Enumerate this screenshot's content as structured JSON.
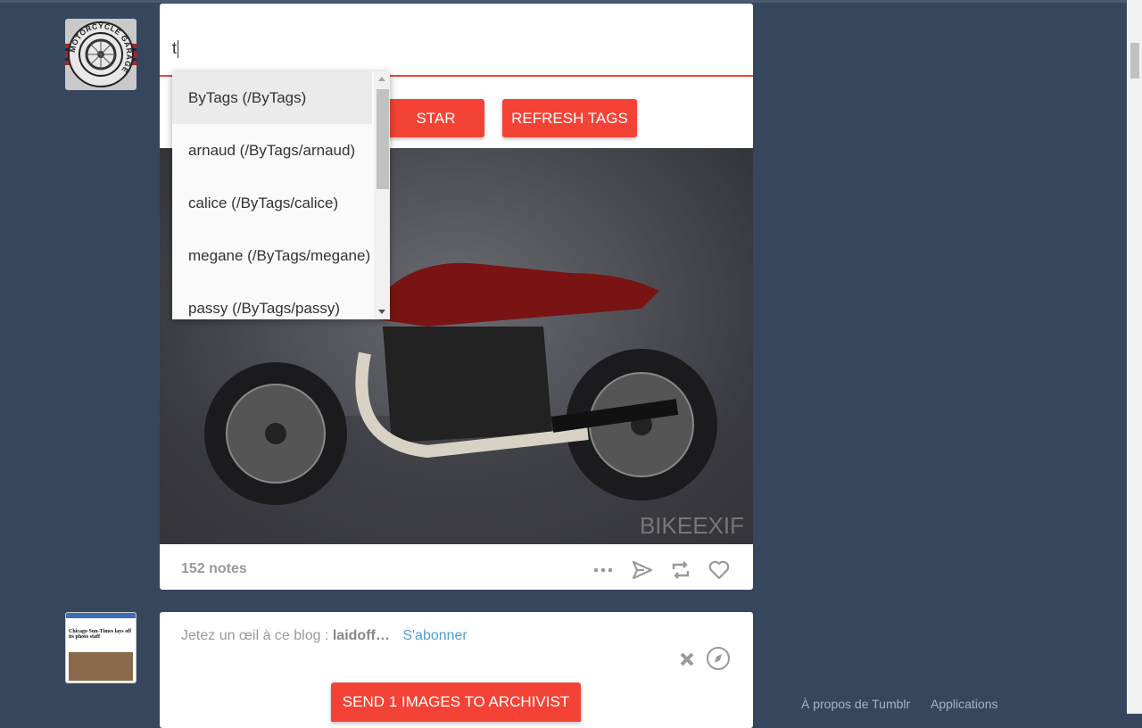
{
  "search": {
    "value": "t"
  },
  "dropdown": {
    "items": [
      {
        "label": "ByTags (/ByTags)"
      },
      {
        "label": "arnaud (/ByTags/arnaud)"
      },
      {
        "label": "calice (/ByTags/calice)"
      },
      {
        "label": "megane (/ByTags/megane)"
      },
      {
        "label": "passy (/ByTags/passy)"
      }
    ]
  },
  "buttons": {
    "star": "STAR",
    "refresh": "REFRESH TAGS",
    "send": "SEND 1 IMAGES TO ARCHIVIST"
  },
  "post": {
    "notes": "152 notes",
    "avatar_text": "MOTORCYCLE GARAGE",
    "watermark": "BIKEEXIF"
  },
  "recommend": {
    "prefix": "Jetez un œil à ce blog : ",
    "blog": "laidoff…",
    "follow": "S'abonner",
    "thumb_headline": "Chicago Sun-Times lays off its photo staff"
  },
  "footer": {
    "about": "À propos de Tumblr",
    "apps": "Applications"
  },
  "colors": {
    "background": "#36465d",
    "accent": "#f44336",
    "link": "#529ecc"
  }
}
